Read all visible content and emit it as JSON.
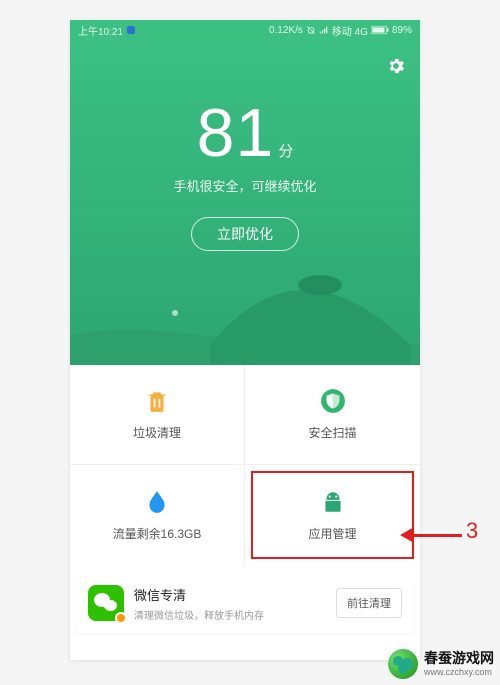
{
  "status_bar": {
    "time": "上午10:21",
    "speed": "0.12K/s",
    "carrier": "移动 4G",
    "battery": "89%"
  },
  "score": {
    "value": "81",
    "unit": "分",
    "subtitle": "手机很安全，可继续优化",
    "button": "立即优化"
  },
  "tiles": {
    "trash": {
      "label": "垃圾清理",
      "icon": "trash-icon",
      "color": "#f6b042"
    },
    "scan": {
      "label": "安全扫描",
      "icon": "shield-icon",
      "color": "#31b66f"
    },
    "data": {
      "label": "流量剩余16.3GB",
      "icon": "droplet-icon",
      "color": "#2196f3"
    },
    "apps": {
      "label": "应用管理",
      "icon": "android-icon",
      "color": "#2aa775"
    }
  },
  "footer": {
    "title": "微信专清",
    "subtitle": "清理微信垃圾，释放手机内存",
    "button": "前往清理"
  },
  "annotation": {
    "number": "3"
  },
  "watermark": {
    "title": "春蚕游戏网",
    "url": "www.czchxy.com"
  }
}
